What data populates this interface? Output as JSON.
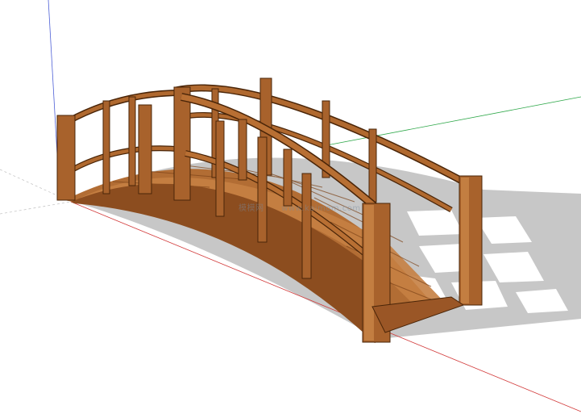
{
  "scene": {
    "subject": "wooden-arched-footbridge",
    "colors": {
      "background": "#ffffff",
      "wood_light": "#c07a3e",
      "wood_mid": "#a8622c",
      "wood_dark": "#7d4318",
      "wood_edge": "#4a2508",
      "shadow": "#bdbdbd",
      "axis_red": "#d23a3a",
      "axis_green": "#2fa84a",
      "axis_blue": "#4d5fd6"
    }
  },
  "watermark": {
    "brand": "模模网",
    "url": "www.kaimom.com"
  }
}
